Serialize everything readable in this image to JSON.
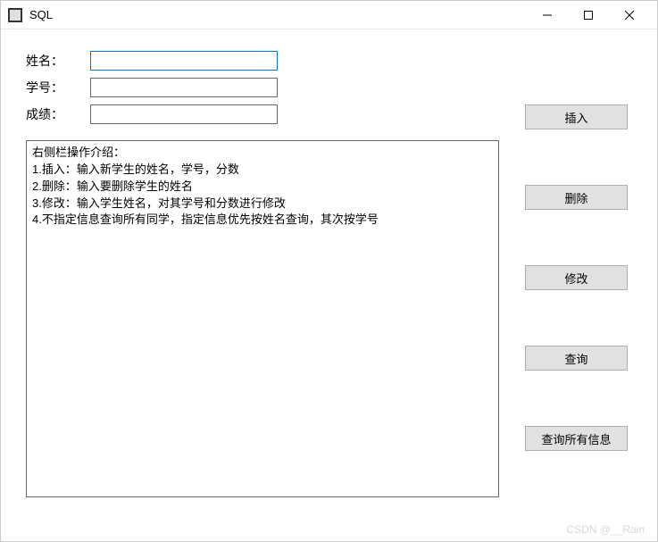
{
  "window": {
    "title": "SQL"
  },
  "form": {
    "name_label": "姓名：",
    "name_value": "",
    "id_label": "学号：",
    "id_value": "",
    "score_label": "成绩：",
    "score_value": ""
  },
  "buttons": {
    "insert": "插入",
    "delete": "删除",
    "update": "修改",
    "query": "查询",
    "query_all": "查询所有信息"
  },
  "info_text": "右侧栏操作介绍：\n1.插入：输入新学生的姓名，学号，分数\n2.删除：输入要删除学生的姓名\n3.修改：输入学生姓名，对其学号和分数进行修改\n4.不指定信息查询所有同学，指定信息优先按姓名查询，其次按学号",
  "watermark": "CSDN @__Rain"
}
